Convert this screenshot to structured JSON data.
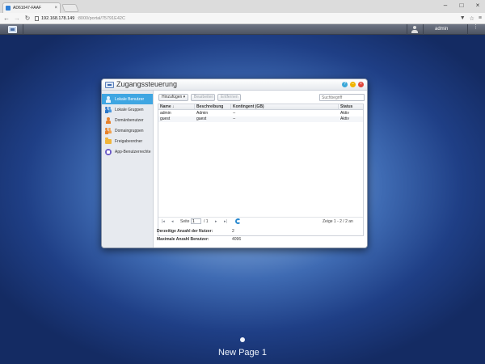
{
  "browser": {
    "tab_title": "AD61047-FAAF",
    "tab_close": "×",
    "url_host": "192.168.178.149",
    "url_path": ":8000/portal/75791E42C",
    "window_controls": {
      "minimize": "–",
      "maximize": "□",
      "close": "×"
    },
    "nav": {
      "back": "←",
      "forward": "→",
      "reload": "↻"
    },
    "addr_icons": {
      "filter": "▼",
      "star": "☆",
      "menu": "≡"
    }
  },
  "taskbar": {
    "user": "admin",
    "more": "⋮"
  },
  "window": {
    "title": "Zugangssteuerung",
    "buttons": {
      "help": "?",
      "minimize": "–",
      "close": "×"
    },
    "sidebar": [
      {
        "label": "Lokale Benutzer",
        "icon": "local-user-icon",
        "active": true
      },
      {
        "label": "Lokale Gruppen",
        "icon": "local-group-icon",
        "active": false
      },
      {
        "label": "Domänbenutzer",
        "icon": "domain-user-icon",
        "active": false
      },
      {
        "label": "Domaingruppen",
        "icon": "domain-group-icon",
        "active": false
      },
      {
        "label": "Freigabeordner",
        "icon": "shared-folder-icon",
        "active": false
      },
      {
        "label": "App-Benutzerrechte",
        "icon": "app-privileges-icon",
        "active": false
      }
    ],
    "toolbar": {
      "add_label": "Hinzufügen ▾",
      "edit_label": "Bearbeiten",
      "remove_label": "Entfernen",
      "search_placeholder": "Suchbegriff"
    },
    "table": {
      "columns": [
        "Name ↓",
        "Beschreibung",
        "Kontingent (GB)",
        "Status"
      ],
      "rows": [
        [
          "admin",
          "Admin",
          "--",
          "Aktiv"
        ],
        [
          "guest",
          "guest",
          "--",
          "Aktiv"
        ]
      ]
    },
    "pager": {
      "first": "|◂",
      "prev": "◂",
      "page_label": "Seite",
      "page_value": "1",
      "page_total": "/ 1",
      "next": "▸",
      "last": "▸|",
      "summary": "Zeige 1 - 2 / 2 an"
    },
    "stats": {
      "current_label": "Derzeitige Anzahl der Nutzer:",
      "current_value": "2",
      "max_label": "Maximale Anzahl Benutzer:",
      "max_value": "4096"
    }
  },
  "desktop": {
    "page_label": "New Page 1"
  },
  "colors": {
    "accent": "#3fa6e2",
    "desktop": "#2a4f99"
  }
}
